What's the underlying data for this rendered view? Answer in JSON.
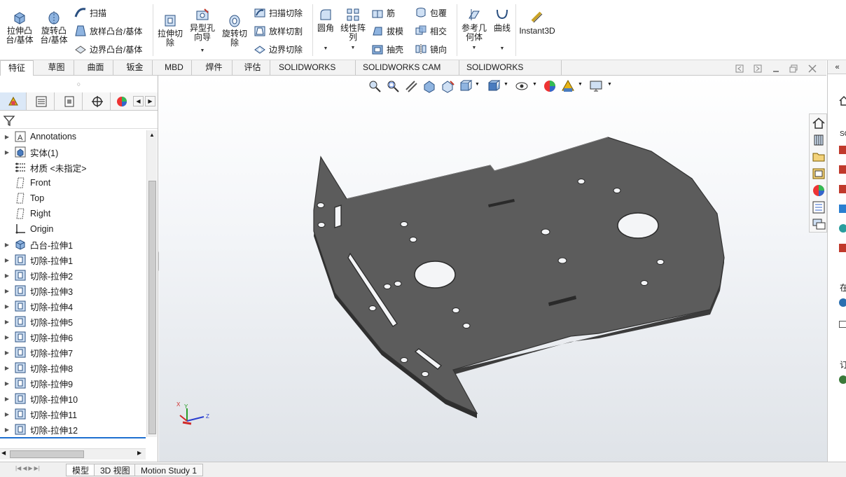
{
  "ribbon": {
    "extrude_boss": "拉伸凸\n台/基体",
    "revolve_boss": "旋转凸\n台/基体",
    "sweep": "扫描",
    "loft_boss": "放样凸台/基体",
    "boundary_boss": "边界凸台/基体",
    "extrude_cut": "拉伸切\n除",
    "hole_wizard": "异型孔\n向导",
    "revolve_cut": "旋转切\n除",
    "sweep_cut": "扫描切除",
    "loft_cut": "放样切割",
    "boundary_cut": "边界切除",
    "fillet": "圆角",
    "linear_pattern": "线性阵\n列",
    "rib": "筋",
    "draft": "拔模",
    "shell": "抽壳",
    "wrap": "包覆",
    "intersect": "相交",
    "mirror": "镜向",
    "reference_geometry": "参考几\n何体",
    "curves": "曲线",
    "instant3d": "Instant3D"
  },
  "tabs": [
    "特征",
    "草图",
    "曲面",
    "钣金",
    "MBD",
    "焊件(D)",
    "评估",
    "SOLIDWORKS CAM",
    "SOLIDWORKS CAM TBM",
    "SOLIDWORKS Inspection"
  ],
  "tree": {
    "items": [
      {
        "label": "Annotations",
        "icon": "annotations-icon",
        "expandable": true
      },
      {
        "label": "实体(1)",
        "icon": "solid-bodies-icon",
        "expandable": true
      },
      {
        "label": "材质 <未指定>",
        "icon": "material-icon",
        "expandable": false
      },
      {
        "label": "Front",
        "icon": "plane-icon",
        "expandable": false
      },
      {
        "label": "Top",
        "icon": "plane-icon",
        "expandable": false
      },
      {
        "label": "Right",
        "icon": "plane-icon",
        "expandable": false
      },
      {
        "label": "Origin",
        "icon": "origin-icon",
        "expandable": false
      },
      {
        "label": "凸台-拉伸1",
        "icon": "boss-extrude-icon",
        "expandable": true
      },
      {
        "label": "切除-拉伸1",
        "icon": "cut-extrude-icon",
        "expandable": true
      },
      {
        "label": "切除-拉伸2",
        "icon": "cut-extrude-icon",
        "expandable": true
      },
      {
        "label": "切除-拉伸3",
        "icon": "cut-extrude-icon",
        "expandable": true
      },
      {
        "label": "切除-拉伸4",
        "icon": "cut-extrude-icon",
        "expandable": true
      },
      {
        "label": "切除-拉伸5",
        "icon": "cut-extrude-icon",
        "expandable": true
      },
      {
        "label": "切除-拉伸6",
        "icon": "cut-extrude-icon",
        "expandable": true
      },
      {
        "label": "切除-拉伸7",
        "icon": "cut-extrude-icon",
        "expandable": true
      },
      {
        "label": "切除-拉伸8",
        "icon": "cut-extrude-icon",
        "expandable": true
      },
      {
        "label": "切除-拉伸9",
        "icon": "cut-extrude-icon",
        "expandable": true
      },
      {
        "label": "切除-拉伸10",
        "icon": "cut-extrude-icon",
        "expandable": true
      },
      {
        "label": "切除-拉伸11",
        "icon": "cut-extrude-icon",
        "expandable": true
      },
      {
        "label": "切除-拉伸12",
        "icon": "cut-extrude-icon",
        "expandable": true
      }
    ]
  },
  "bottom_tabs": [
    "模型",
    "3D 视图",
    "Motion Study 1"
  ],
  "right_panel": {
    "label_so": "SC",
    "label_zai": "在",
    "label_ding": "订"
  },
  "triad": {
    "x": "X",
    "y": "Y",
    "z": "Z"
  },
  "colors": {
    "accent": "#1e6fd0",
    "part_top": "#5a5a5a",
    "part_edge": "#3a3a3a"
  }
}
